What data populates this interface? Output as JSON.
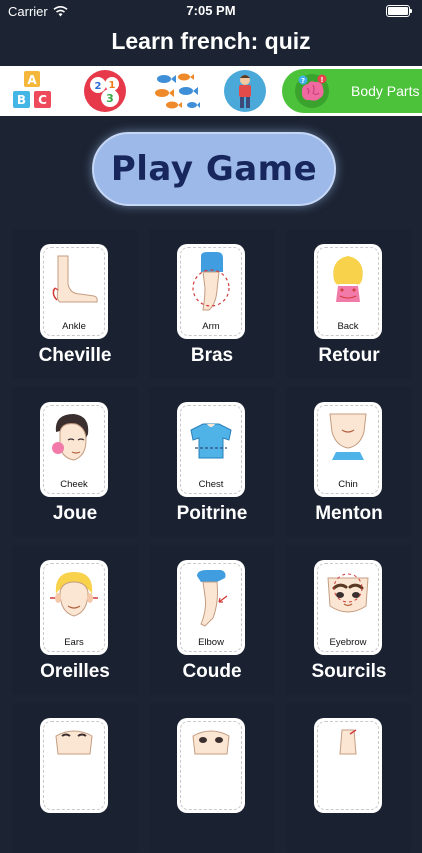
{
  "status_bar": {
    "carrier": "Carrier",
    "time": "7:05 PM"
  },
  "header": {
    "title": "Learn french: quiz"
  },
  "categories": [
    {
      "name": "abc-blocks-icon"
    },
    {
      "name": "numbers-icon"
    },
    {
      "name": "fish-icon"
    },
    {
      "name": "person-icon"
    },
    {
      "name": "brain-icon",
      "label": "Body Parts"
    }
  ],
  "play_button": {
    "label": "Play Game"
  },
  "body_parts": [
    {
      "english": "Ankle",
      "french": "Cheville",
      "icon": "ankle-icon"
    },
    {
      "english": "Arm",
      "french": "Bras",
      "icon": "arm-icon"
    },
    {
      "english": "Back",
      "french": "Retour",
      "icon": "back-icon"
    },
    {
      "english": "Cheek",
      "french": "Joue",
      "icon": "cheek-icon"
    },
    {
      "english": "Chest",
      "french": "Poitrine",
      "icon": "chest-icon"
    },
    {
      "english": "Chin",
      "french": "Menton",
      "icon": "chin-icon"
    },
    {
      "english": "Ears",
      "french": "Oreilles",
      "icon": "ears-icon"
    },
    {
      "english": "Elbow",
      "french": "Coude",
      "icon": "elbow-icon"
    },
    {
      "english": "Eyebrow",
      "french": "Sourcils",
      "icon": "eyebrow-icon"
    }
  ],
  "colors": {
    "background": "#1c2433",
    "play_button": "#9cb9ea",
    "category_active": "#4cc13a"
  }
}
